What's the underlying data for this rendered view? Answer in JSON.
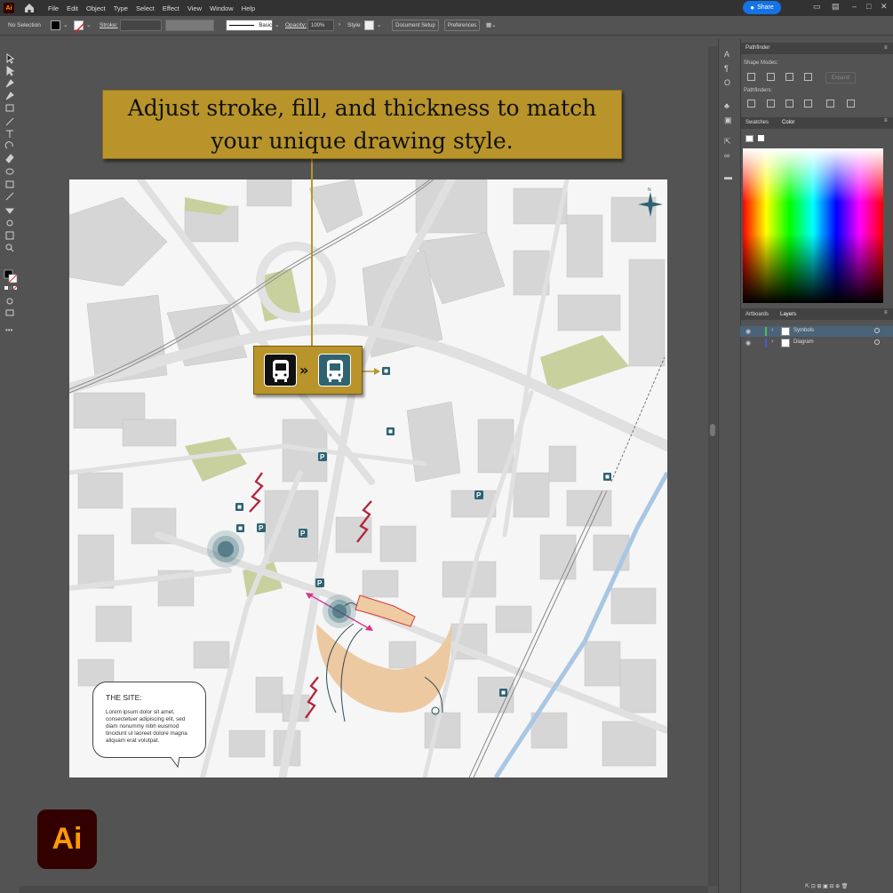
{
  "app": {
    "badge": "Ai",
    "share_label": "Share"
  },
  "menu": [
    "File",
    "Edit",
    "Object",
    "Type",
    "Select",
    "Effect",
    "View",
    "Window",
    "Help"
  ],
  "control_bar": {
    "selection": "No Selection",
    "stroke_label": "Stroke:",
    "brush_label": "Basic",
    "opacity_label": "Opacity:",
    "opacity_value": "100%",
    "style_label": "Style:",
    "doc_setup": "Document Setup",
    "preferences": "Preferences"
  },
  "panels": {
    "pathfinder_tab": "Pathfinder",
    "shape_modes": "Shape Modes:",
    "pathfinders": "Pathfinders:",
    "expand": "Expand",
    "swatches_tab": "Swatches",
    "color_tab": "Color",
    "artboards_tab": "Artboards",
    "layers_tab": "Layers",
    "layers": [
      {
        "name": "Symbols",
        "color": "#4cc24c"
      },
      {
        "name": "Diagram",
        "color": "#4b5bd9"
      }
    ]
  },
  "callout": {
    "text": "Adjust stroke, fill, and thickness to match your unique drawing style."
  },
  "bus_icons": {
    "left": "bus-icon-black",
    "right": "bus-icon-teal",
    "arrow": "»"
  },
  "map_labels": {
    "parking": "P",
    "north": "N"
  },
  "site_note": {
    "title": "THE SITE:",
    "body": "Lorem ipsum dolor sit amet, consectetuer adipiscing elit, sed diam nonummy nibh euismod tincidunt ut laoreet dolore magna aliquam erat volutpat."
  },
  "logo": {
    "text": "Ai"
  },
  "colors": {
    "callout_bg": "#b8942a",
    "teal": "#2f6371",
    "accent_red": "#b3243c",
    "peach": "#eccba0",
    "green": "#c6cf9a",
    "share": "#1473e6",
    "logo_text": "#ff9a00",
    "logo_bg": "#330000"
  }
}
